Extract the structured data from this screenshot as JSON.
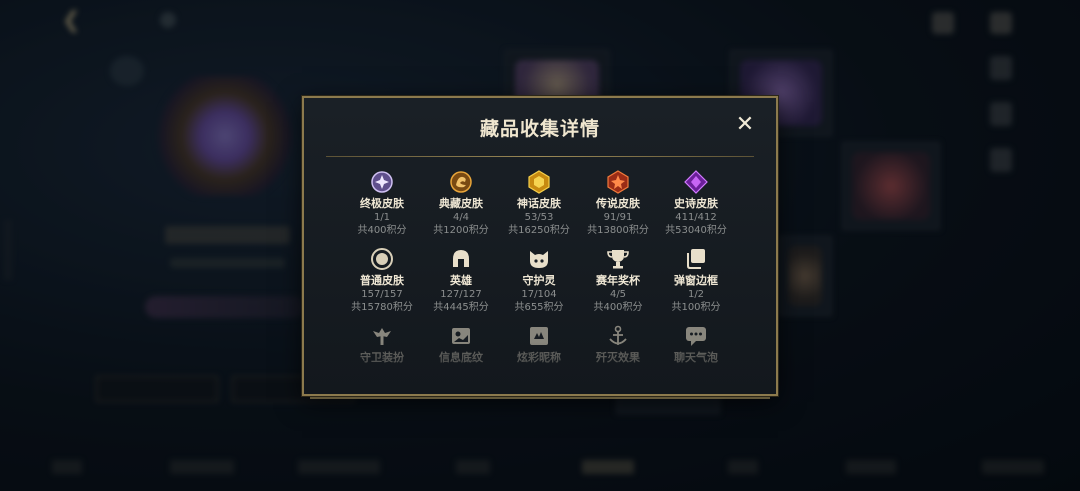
{
  "modal": {
    "title": "藏品收集详情",
    "close_label": "✕"
  },
  "collection": {
    "rows": [
      [
        {
          "name": "终极皮肤",
          "count": "1/1",
          "points": "共400积分",
          "icon": "ultimate-skin-icon",
          "color": "#b9a6e8"
        },
        {
          "name": "典藏皮肤",
          "count": "4/4",
          "points": "共1200积分",
          "icon": "prestige-skin-icon",
          "color": "#e8a53a"
        },
        {
          "name": "神话皮肤",
          "count": "53/53",
          "points": "共16250积分",
          "icon": "mythic-skin-icon",
          "color": "#e8b624"
        },
        {
          "name": "传说皮肤",
          "count": "91/91",
          "points": "共13800积分",
          "icon": "legendary-skin-icon",
          "color": "#e2562b"
        },
        {
          "name": "史诗皮肤",
          "count": "411/412",
          "points": "共53040积分",
          "icon": "epic-skin-icon",
          "color": "#a645d6"
        }
      ],
      [
        {
          "name": "普通皮肤",
          "count": "157/157",
          "points": "共15780积分",
          "icon": "standard-skin-icon",
          "color": "#d8cfb8"
        },
        {
          "name": "英雄",
          "count": "127/127",
          "points": "共4445积分",
          "icon": "champion-helmet-icon",
          "color": "#e8dfca"
        },
        {
          "name": "守护灵",
          "count": "17/104",
          "points": "共655积分",
          "icon": "guardian-pet-icon",
          "color": "#e8dfca"
        },
        {
          "name": "赛年奖杯",
          "count": "4/5",
          "points": "共400积分",
          "icon": "season-trophy-icon",
          "color": "#e8dfca"
        },
        {
          "name": "弹窗边框",
          "count": "1/2",
          "points": "共100积分",
          "icon": "popup-frame-icon",
          "color": "#e8dfca"
        }
      ],
      [
        {
          "name": "守卫装扮",
          "icon": "ward-skin-icon",
          "color": "#e8dfca"
        },
        {
          "name": "信息底纹",
          "icon": "info-pattern-icon",
          "color": "#e8dfca"
        },
        {
          "name": "炫彩昵称",
          "icon": "chroma-nickname-icon",
          "color": "#e8dfca"
        },
        {
          "name": "歼灭效果",
          "icon": "ace-effect-icon",
          "color": "#e8dfca"
        },
        {
          "name": "聊天气泡",
          "icon": "chat-bubble-icon",
          "color": "#e8dfca"
        }
      ]
    ]
  },
  "colors": {
    "gold_border": "#8c7a4d",
    "modal_bg": "#161c21",
    "title": "#efe6cf"
  }
}
